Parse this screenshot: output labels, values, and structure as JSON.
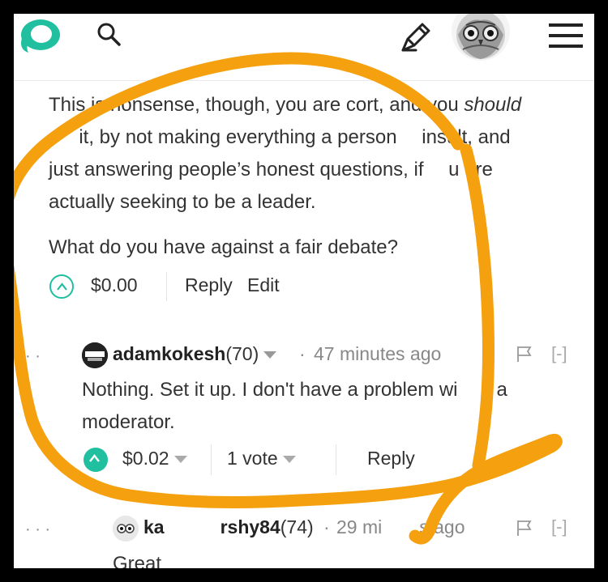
{
  "header": {
    "logo_icon": "steemit-logo-icon",
    "search_icon": "search-icon",
    "submit_icon": "pencil-icon",
    "menu_icon": "hamburger-menu-icon",
    "brand_color": "#1fbfa0"
  },
  "comment": {
    "para1_a": "This is ",
    "para1_b": "nonsense, though, you are cor",
    "para1_c": "t, and you ",
    "para1_em": "should",
    "para2": "e it, by not making everything a person  insult, and",
    "para3": "just answering people’s honest questions, if  u are",
    "para4": "actually seeking to be a leader.",
    "question": "What do you have against a fair debate?",
    "payout": "$0.00",
    "reply_label": "Reply",
    "edit_label": "Edit"
  },
  "reply1": {
    "dots": "· ·",
    "author": "adamkokesh",
    "reputation": "(70)",
    "separator": "·",
    "time": "47 minutes ago",
    "collapse": "[-]",
    "line1": "Nothing. Set it up. I don't have a problem wi  a",
    "line2": "moderator.",
    "payout": "$0.02",
    "votes": "1 vote",
    "reply_label": "Reply"
  },
  "reply2": {
    "dots": "· · ·",
    "author": "ka   rshy84",
    "reputation": "(74)",
    "separator": "·",
    "time": "29 mi  s ago",
    "collapse": "[-]",
    "line1": "Great"
  },
  "annotation": {
    "color": "#f5a00f"
  }
}
